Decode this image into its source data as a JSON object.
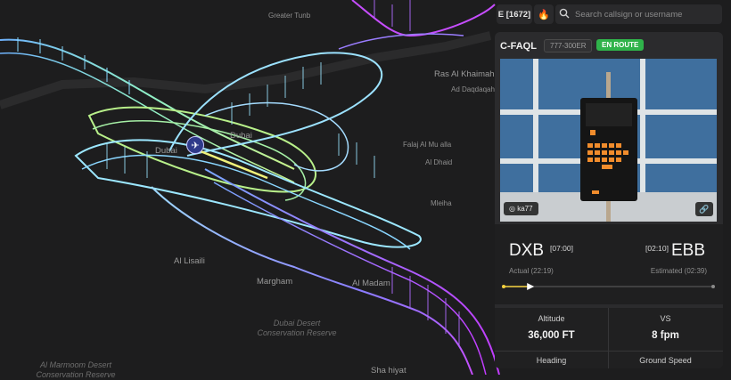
{
  "map": {
    "labels": {
      "greater_tunb": "Greater Tunb",
      "ras_al_khaimah": "Ras Al Khaimah",
      "ad_daqdaqah": "Ad Daqdaqah",
      "dubai_1": "Dubai",
      "dubai_2": "Dubai",
      "falaj": "Falaj Al Mu alla",
      "al_dhaid": "Al Dhaid",
      "mleiha": "Mleiha",
      "al_lisaili": "Al Lisaili",
      "margham": "Margham",
      "al_madam": "Al Madam",
      "dubai_desert": "Dubai Desert",
      "conservation_reserve": "Conservation Reserve",
      "al_marmoom": "Al Marmoom Desert",
      "conservation_reserve_2": "Conservation Reserve",
      "shahiyat": "Sha hiyat"
    }
  },
  "topbar": {
    "selector_label": "E [1672]",
    "flame_icon": "🔥",
    "search_placeholder": "Search callsign or username"
  },
  "flight": {
    "callsign": "C-FAQL",
    "aircraft_type": "777-300ER",
    "status": "EN ROUTE",
    "photo_credit": "ka77",
    "origin": "DXB",
    "origin_time": "[07:00]",
    "destination": "EBB",
    "destination_time": "[02:10]",
    "actual": "Actual (22:19)",
    "estimated": "Estimated (02:39)",
    "progress": 0.12,
    "colors": {
      "status_green": "#2fb34a",
      "progress_yellow": "#f4d03f"
    }
  },
  "stats": {
    "altitude_label": "Altitude",
    "altitude_value": "36,000 FT",
    "vs_label": "VS",
    "vs_value": "8 fpm",
    "heading_label": "Heading",
    "ground_speed_label": "Ground Speed"
  }
}
